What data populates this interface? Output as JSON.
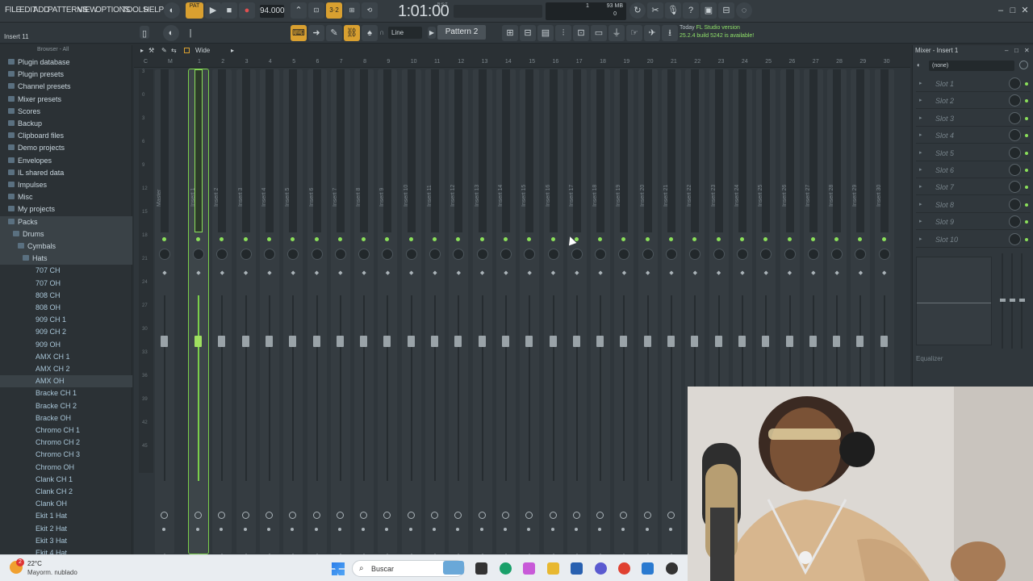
{
  "menu": [
    "FILE",
    "EDIT",
    "ADD",
    "PATTERNS",
    "VIEW",
    "OPTIONS",
    "TOOLS",
    "HELP"
  ],
  "transport": {
    "pat_label": "PAT",
    "bpm": "94.000",
    "time": "1:01:00",
    "time_sub": "B:S:T",
    "mem": "93 MB",
    "cpu": "1",
    "voices": "0"
  },
  "toolbar2": {
    "hint": "Insert 11",
    "snap": "Line",
    "pattern": "Pattern 2"
  },
  "news": {
    "line1": "Today",
    "line1b": "FL Studio version",
    "line2": "25.2.4 build 5242 is available!"
  },
  "browser": {
    "title": "Browser - All",
    "items": [
      {
        "label": "Plugin database",
        "type": "folder",
        "sel": false
      },
      {
        "label": "Plugin presets",
        "type": "folder",
        "sel": false
      },
      {
        "label": "Channel presets",
        "type": "folder",
        "sel": false
      },
      {
        "label": "Mixer presets",
        "type": "folder",
        "sel": false
      },
      {
        "label": "Scores",
        "type": "folder",
        "sel": false
      },
      {
        "label": "Backup",
        "type": "folder",
        "sel": false
      },
      {
        "label": "Clipboard files",
        "type": "folder",
        "sel": false
      },
      {
        "label": "Demo projects",
        "type": "folder",
        "sel": false
      },
      {
        "label": "Envelopes",
        "type": "folder",
        "sel": false
      },
      {
        "label": "IL shared data",
        "type": "folder",
        "sel": false
      },
      {
        "label": "Impulses",
        "type": "folder",
        "sel": false
      },
      {
        "label": "Misc",
        "type": "folder",
        "sel": false
      },
      {
        "label": "My projects",
        "type": "folder",
        "sel": false
      },
      {
        "label": "Packs",
        "type": "folder",
        "sel": true
      },
      {
        "label": "Drums",
        "type": "folder",
        "sel": true
      },
      {
        "label": "Cymbals",
        "type": "folder",
        "sel": true
      },
      {
        "label": "Hats",
        "type": "folder",
        "sel": true
      },
      {
        "label": "707 CH",
        "type": "file",
        "sel": false
      },
      {
        "label": "707 OH",
        "type": "file",
        "sel": false
      },
      {
        "label": "808 CH",
        "type": "file",
        "sel": false
      },
      {
        "label": "808 OH",
        "type": "file",
        "sel": false
      },
      {
        "label": "909 CH 1",
        "type": "file",
        "sel": false
      },
      {
        "label": "909 CH 2",
        "type": "file",
        "sel": false
      },
      {
        "label": "909 OH",
        "type": "file",
        "sel": false
      },
      {
        "label": "AMX CH 1",
        "type": "file",
        "sel": false
      },
      {
        "label": "AMX CH 2",
        "type": "file",
        "sel": false
      },
      {
        "label": "AMX OH",
        "type": "file",
        "sel": true
      },
      {
        "label": "Bracke CH 1",
        "type": "file",
        "sel": false
      },
      {
        "label": "Bracke CH 2",
        "type": "file",
        "sel": false
      },
      {
        "label": "Bracke OH",
        "type": "file",
        "sel": false
      },
      {
        "label": "Chromo CH 1",
        "type": "file",
        "sel": false
      },
      {
        "label": "Chromo CH 2",
        "type": "file",
        "sel": false
      },
      {
        "label": "Chromo CH 3",
        "type": "file",
        "sel": false
      },
      {
        "label": "Chromo OH",
        "type": "file",
        "sel": false
      },
      {
        "label": "Clank CH 1",
        "type": "file",
        "sel": false
      },
      {
        "label": "Clank CH 2",
        "type": "file",
        "sel": false
      },
      {
        "label": "Clank OH",
        "type": "file",
        "sel": false
      },
      {
        "label": "Ekit 1 Hat",
        "type": "file",
        "sel": false
      },
      {
        "label": "Ekit 2 Hat",
        "type": "file",
        "sel": false
      },
      {
        "label": "Ekit 3 Hat",
        "type": "file",
        "sel": false
      },
      {
        "label": "Ekit 4 Hat",
        "type": "file",
        "sel": false
      }
    ]
  },
  "mixer": {
    "view": "Wide",
    "master_label": "Master",
    "ruler": [
      "C",
      "M",
      "1",
      "2",
      "3",
      "4",
      "5",
      "6",
      "7",
      "8",
      "9",
      "10",
      "11",
      "12",
      "13",
      "14",
      "15",
      "16",
      "17",
      "18",
      "19",
      "20",
      "21",
      "22",
      "23",
      "24",
      "25",
      "26",
      "27",
      "28",
      "29",
      "30"
    ],
    "inserts": [
      "Insert 1",
      "Insert 2",
      "Insert 3",
      "Insert 4",
      "Insert 5",
      "Insert 6",
      "Insert 7",
      "Insert 8",
      "Insert 9",
      "Insert 10",
      "Insert 11",
      "Insert 12",
      "Insert 13",
      "Insert 14",
      "Insert 15",
      "Insert 16",
      "Insert 17",
      "Insert 18",
      "Insert 19",
      "Insert 20",
      "Insert 21",
      "Insert 22",
      "Insert 23",
      "Insert 24",
      "Insert 25",
      "Insert 26",
      "Insert 27",
      "Insert 28",
      "Insert 29",
      "Insert 30",
      "Insert 31"
    ],
    "selected_insert": "Insert 1",
    "db_scale": [
      "3",
      "0",
      "3",
      "6",
      "9",
      "12",
      "15",
      "18",
      "21",
      "24",
      "27",
      "30",
      "33",
      "36",
      "39",
      "42",
      "45"
    ]
  },
  "insert_panel": {
    "title": "Mixer - Insert 1",
    "preset": "(none)",
    "slots": [
      "Slot 1",
      "Slot 2",
      "Slot 3",
      "Slot 4",
      "Slot 5",
      "Slot 6",
      "Slot 7",
      "Slot 8",
      "Slot 9",
      "Slot 10"
    ],
    "eq_label": "Equalizer"
  },
  "taskbar": {
    "temp": "22°C",
    "weather": "Mayorm. nublado",
    "search": "Buscar",
    "badge": "2"
  },
  "colors": {
    "accent": "#8be05a",
    "panel": "#2f363b",
    "selected_outline": "#7ad04a"
  }
}
